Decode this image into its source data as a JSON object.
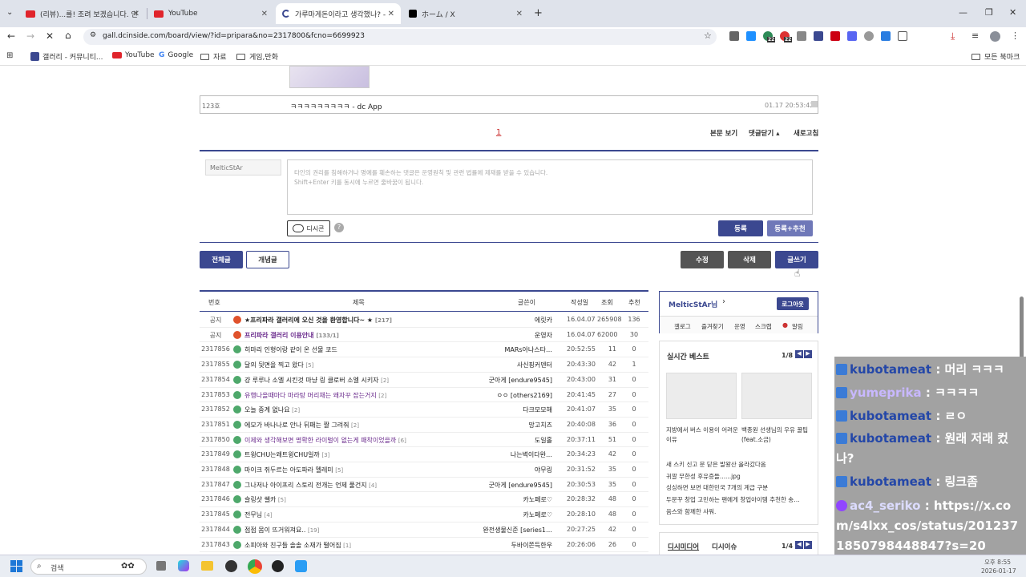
{
  "browser": {
    "tabs": [
      {
        "title": "(리뷰)...를! 조려 보겠습니다. 인",
        "favicon": "#e0242b"
      },
      {
        "title": "YouTube",
        "favicon": "#e0242b"
      },
      {
        "title": "가루마게돈이라고 생각했나? -",
        "favicon": "#3b4890"
      },
      {
        "title": "ホーム / X",
        "favicon": "#000000"
      }
    ],
    "new_tab": "+",
    "url": "gall.dcinside.com/board/view/?id=pripara&no=2317800&fcno=6699923",
    "ext_badges": [
      "22",
      "22"
    ],
    "bookmarks": [
      "갤러리 - 커뮤니티...",
      "YouTube",
      "Google",
      "자료",
      "게임,만화"
    ],
    "all_bookmarks": "모든 북마크"
  },
  "comment": {
    "num": "123호",
    "text": "ㅋㅋㅋㅋㅋㅋㅋㅋㅋ - dc App",
    "time": "01.17 20:53:42"
  },
  "pager": {
    "current": "1"
  },
  "view_links": {
    "view_body": "본문 보기",
    "close_comments": "댓글닫기 ▴",
    "refresh": "새로고침"
  },
  "write": {
    "nick": "MelticStAr",
    "placeholder_line1": "타인의 권리를 침해하거나 명예를 훼손하는 댓글은 운영원칙 및 관련 법률에 제재를 받을 수 있습니다.",
    "placeholder_line2": "Shift+Enter 키를 동시에 누르면 줄바꿈이 됩니다.",
    "dccon": "디시콘",
    "help": "?",
    "submit": "등록",
    "submit_recommend": "등록+추천"
  },
  "board_buttons": {
    "all": "전체글",
    "recommended": "개념글",
    "edit": "수정",
    "delete": "삭제",
    "write": "글쓰기"
  },
  "list": {
    "headers": {
      "num": "번호",
      "title": "제목",
      "writer": "글쓴이",
      "date": "작성일",
      "views": "조회",
      "recommend": "추천"
    },
    "rows": [
      {
        "num": "공지",
        "title": "★프리파라 갤러리에 오신 것을 환영합니다~ ★",
        "cc": "[217]",
        "writer": "에릿카",
        "date": "16.04.07",
        "views": "265908",
        "rec": "136",
        "notice": true,
        "bold": true,
        "purple": false
      },
      {
        "num": "공지",
        "title": "프리파라 갤러리 이용안내",
        "cc": "[133/1]",
        "writer": "운영자",
        "date": "16.04.07",
        "views": "62000",
        "rec": "30",
        "notice": true,
        "bold": true,
        "purple": true
      },
      {
        "num": "2317856",
        "title": "히마리 인형이랑 같이 온 선물 코드",
        "cc": "",
        "writer": "MARs아나스타…",
        "date": "20:52:55",
        "views": "11",
        "rec": "0"
      },
      {
        "num": "2317855",
        "title": "달의 뒷면을 찍고 왔다",
        "cc": "[5]",
        "writer": "사신핑커덴터",
        "date": "20:43:30",
        "views": "42",
        "rec": "1"
      },
      {
        "num": "2317854",
        "title": "걍 루루나 소엘 시킨것 마냥 링 클로버 소엘 시키자",
        "cc": "[2]",
        "writer": "군아게 [endure9545]",
        "date": "20:43:00",
        "views": "31",
        "rec": "0"
      },
      {
        "num": "2317853",
        "title": "유행나올때마다 마라탕 머리채는 왜자꾸 잡는거지",
        "cc": "[2]",
        "writer": "ㅇㅇ [others2169]",
        "date": "20:41:45",
        "views": "27",
        "rec": "0",
        "purple": true
      },
      {
        "num": "2317852",
        "title": "오늘 중계 없나요",
        "cc": "[2]",
        "writer": "다크모모해",
        "date": "20:41:07",
        "views": "35",
        "rec": "0"
      },
      {
        "num": "2317851",
        "title": "에모가 바나나로 안나 뒤패는 짤 그려줘",
        "cc": "[2]",
        "writer": "망고치즈",
        "date": "20:40:08",
        "views": "36",
        "rec": "0"
      },
      {
        "num": "2317850",
        "title": "이제와 생각해보면 명확한 라이벌이 없는게 패착이었을까",
        "cc": "[6]",
        "writer": "도일홀",
        "date": "20:37:11",
        "views": "51",
        "rec": "0",
        "purple": true
      },
      {
        "num": "2317849",
        "title": "트윙CHU는왜트윙CHU일까",
        "cc": "[3]",
        "writer": "나는벽이다완…",
        "date": "20:34:23",
        "views": "42",
        "rec": "0"
      },
      {
        "num": "2317848",
        "title": "마이크 쥐두르는 아도파라 멜레미",
        "cc": "[5]",
        "writer": "야무링",
        "date": "20:31:52",
        "views": "35",
        "rec": "0"
      },
      {
        "num": "2317847",
        "title": "그나저나 아이프리 스토리 전개는 언제 풀건지",
        "cc": "[4]",
        "writer": "군아게 [endure9545]",
        "date": "20:30:53",
        "views": "35",
        "rec": "0"
      },
      {
        "num": "2317846",
        "title": "슬링샷 쌜카",
        "cc": "[5]",
        "writer": "카노페로♡",
        "date": "20:28:32",
        "views": "48",
        "rec": "0"
      },
      {
        "num": "2317845",
        "title": "전무님",
        "cc": "[4]",
        "writer": "카노페로♡",
        "date": "20:28:10",
        "views": "48",
        "rec": "0"
      },
      {
        "num": "2317844",
        "title": "점점 몸이 뜨거워져요..",
        "cc": "[19]",
        "writer": "완전생물신준 [series1…",
        "date": "20:27:25",
        "views": "42",
        "rec": "0"
      },
      {
        "num": "2317843",
        "title": "소피아와 친구들 솔솔 소재가 떨어짐",
        "cc": "[1]",
        "writer": "두바이쫀득한우",
        "date": "20:26:06",
        "views": "26",
        "rec": "0"
      }
    ]
  },
  "sidebar": {
    "user": "MelticStAr님",
    "logout": "로그아웃",
    "menu": [
      "갤로그",
      "즐겨찾기",
      "운영",
      "스크랩",
      "알림"
    ],
    "best_title": "실시간 베스트",
    "best_page": "1/8",
    "thumbs": [
      {
        "caption": "지방에서 버스 이용이 어려운 이유"
      },
      {
        "caption": "백종원 선생님의 우유 꿀팁(feat.소금)"
      }
    ],
    "best_list": [
      "새 스키 신고 문 닫은 발왕산 올라갔다옴",
      "귀깔 무한성 후유증들......jpg",
      "싱싱하면 보면 대한민국 7개의 계급 구분",
      "두문꾸 창업 고민하는 팬에게 창업아이템 추천한 송…",
      "음스와 함께한 샤워."
    ],
    "dc_media": "디시미디어",
    "dc_issue": "디시이슈",
    "media_page": "1/4"
  },
  "chat": [
    {
      "user": "kubotameat",
      "text": " : 머리 ㅋㅋㅋ",
      "color": "#2447a8"
    },
    {
      "user": "yumeprika",
      "text": " : ㅋㅋㅋㅋ",
      "color": "#b9a6ff"
    },
    {
      "user": "kubotameat",
      "text": " : ㄹㅇ",
      "color": "#2447a8"
    },
    {
      "user": "kubotameat",
      "text": " : 원래 저래 컸나?",
      "color": "#2447a8"
    },
    {
      "user": "kubotameat",
      "text": " : 링크좀",
      "color": "#2447a8"
    },
    {
      "user": "ac4_seriko",
      "text": " : https://x.com/s4lxx_cos/status/2012371850798448847?s=20",
      "color": "#d9d9ff"
    }
  ],
  "taskbar": {
    "search": "검색",
    "time": "오후 8:55",
    "date": "2026-01-17"
  }
}
